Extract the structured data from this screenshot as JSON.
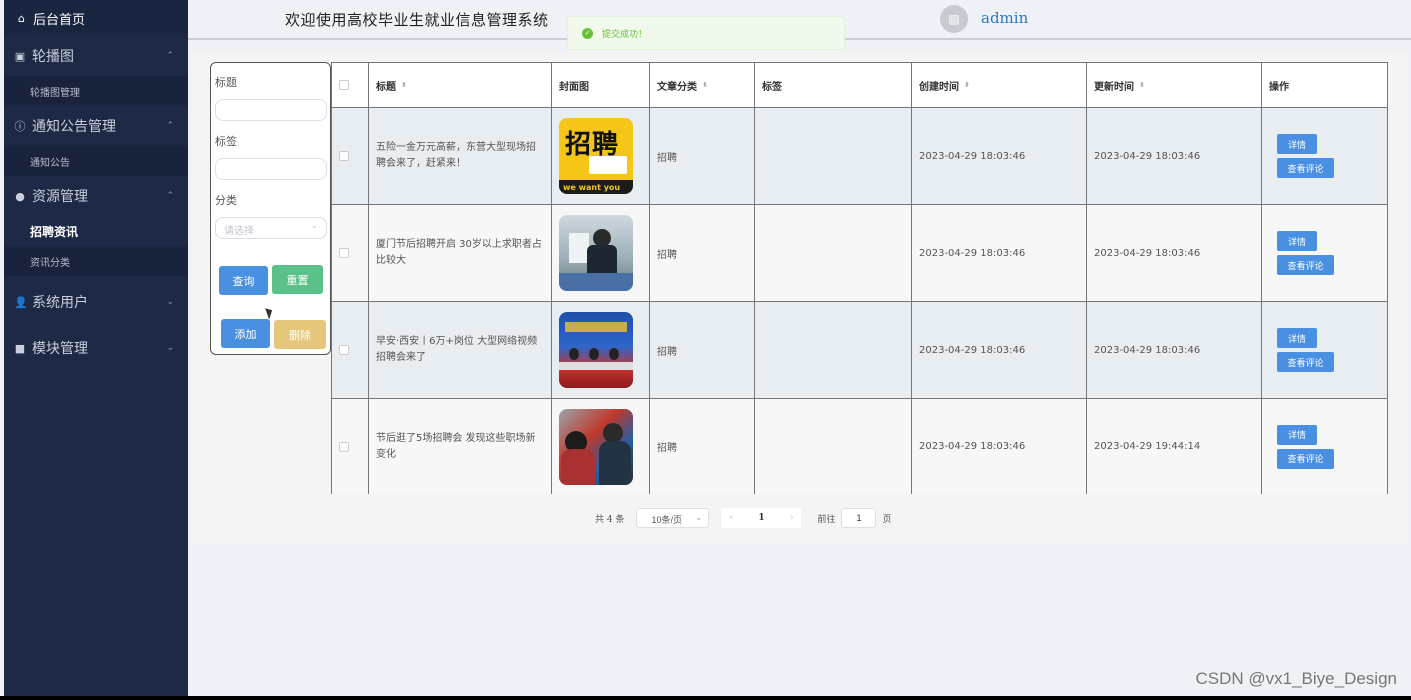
{
  "sidebar": {
    "home": "后台首页",
    "groups": [
      {
        "label": "轮播图",
        "subs": [
          "轮播图管理"
        ]
      },
      {
        "label": "通知公告管理",
        "subs": [
          "通知公告"
        ]
      },
      {
        "label": "资源管理",
        "subs": [
          "招聘资讯",
          "资讯分类"
        ]
      },
      {
        "label": "系统用户",
        "subs": []
      },
      {
        "label": "模块管理",
        "subs": []
      }
    ]
  },
  "header": {
    "welcome": "欢迎使用高校毕业生就业信息管理系统",
    "username": "admin"
  },
  "toast": "提交成功！",
  "filter": {
    "title_label": "标题",
    "tag_label": "标签",
    "category_label": "分类",
    "category_placeholder": "请选择",
    "query_button": "查询",
    "reset_button": "重置",
    "add_button": "添加",
    "delete_button": "删除"
  },
  "table": {
    "columns": [
      "标题",
      "封面图",
      "文章分类",
      "标签",
      "创建时间",
      "更新时间",
      "操作"
    ],
    "detail_label": "详情",
    "comments_label": "查看评论",
    "rows": [
      {
        "title": "五险一金万元高薪，东营大型现场招聘会来了，赶紧来！",
        "category": "招聘",
        "tag": "",
        "created": "2023-04-29 18:03:46",
        "updated": "2023-04-29 18:03:46",
        "thumb_text": "招聘",
        "thumb_sub": "we want you"
      },
      {
        "title": "厦门节后招聘开启 30岁以上求职者占比较大",
        "category": "招聘",
        "tag": "",
        "created": "2023-04-29 18:03:46",
        "updated": "2023-04-29 18:03:46"
      },
      {
        "title": "早安·西安丨6万+岗位 大型网络视频招聘会来了",
        "category": "招聘",
        "tag": "",
        "created": "2023-04-29 18:03:46",
        "updated": "2023-04-29 18:03:46"
      },
      {
        "title": "节后逛了5场招聘会 发现这些职场新变化",
        "category": "招聘",
        "tag": "",
        "created": "2023-04-29 18:03:46",
        "updated": "2023-04-29 19:44:14"
      }
    ]
  },
  "pager": {
    "total": "共 4 条",
    "size": "10条/页",
    "page": "1",
    "goto_prefix": "前往",
    "goto_value": "1",
    "goto_suffix": "页"
  },
  "watermark": "CSDN @vx1_Biye_Design",
  "colors": {
    "sidebar_bg": "#1e2a45",
    "primary": "#4a90e2",
    "success": "#5cc08a",
    "warning": "#e5c77c"
  }
}
